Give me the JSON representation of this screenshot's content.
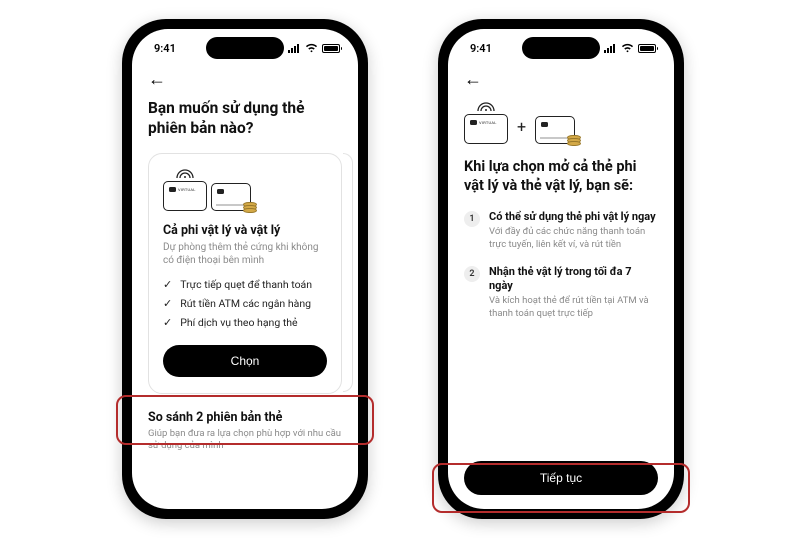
{
  "status": {
    "time": "9:41"
  },
  "screen1": {
    "title": "Bạn muốn sử dụng thẻ phiên bản nào?",
    "option": {
      "title": "Cả phi vật lý và vật lý",
      "desc": "Dự phòng thêm thẻ cứng khi không có điện thoại bên mình",
      "features": {
        "f1": "Trực tiếp quẹt để thanh toán",
        "f2": "Rút tiền ATM các ngân hàng",
        "f3": "Phí dịch vụ theo hạng thẻ"
      },
      "cta": "Chọn"
    },
    "compare": {
      "title": "So sánh 2 phiên bản thẻ",
      "desc": "Giúp bạn đưa ra lựa chọn phù hợp với nhu cầu sử dụng của mình"
    }
  },
  "screen2": {
    "title": "Khi lựa chọn mở cả thẻ phi vật lý và thẻ vật lý, bạn sẽ:",
    "items": {
      "i1": {
        "title": "Có thể sử dụng thẻ phi vật lý ngay",
        "desc": "Với đầy đủ các chức năng thanh toán trực tuyến, liên kết ví, và rút tiền"
      },
      "i2": {
        "title": "Nhận thẻ vật lý trong tối đa 7 ngày",
        "desc": "Và kích hoạt thẻ để rút tiền tại ATM và thanh toán quẹt trực tiếp"
      }
    },
    "cta": "Tiếp tục"
  }
}
